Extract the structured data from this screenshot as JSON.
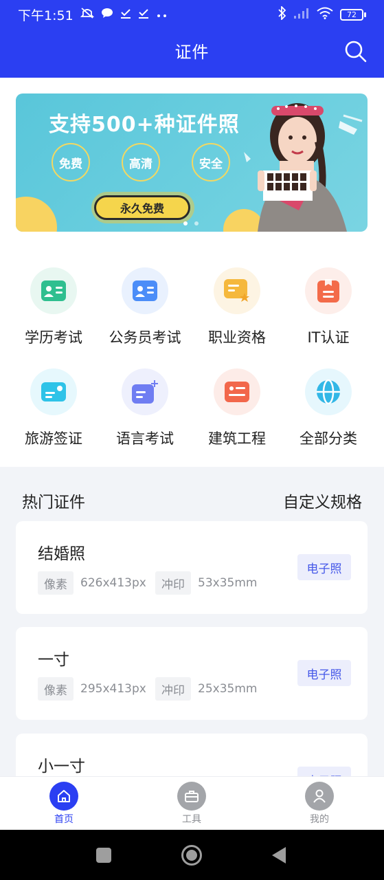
{
  "status_bar": {
    "time": "下午1:51",
    "battery": "72"
  },
  "header": {
    "title": "证件"
  },
  "banner": {
    "title": "支持500+种证件照",
    "badges": [
      "免费",
      "高清",
      "安全"
    ],
    "cta": "永久免费"
  },
  "categories": [
    {
      "label": "学历考试",
      "icon": "student-id-icon",
      "color": "#2fbf8f",
      "bg": "#e8f7f1"
    },
    {
      "label": "公务员考试",
      "icon": "id-card-icon",
      "color": "#4b8df8",
      "bg": "#e9f1fe"
    },
    {
      "label": "职业资格",
      "icon": "certificate-icon",
      "color": "#f5b83d",
      "bg": "#fdf4e3"
    },
    {
      "label": "IT认证",
      "icon": "badge-icon",
      "color": "#f36b4a",
      "bg": "#fdeeea"
    },
    {
      "label": "旅游签证",
      "icon": "visa-icon",
      "color": "#2ec3e8",
      "bg": "#e6f8fd"
    },
    {
      "label": "语言考试",
      "icon": "language-icon",
      "color": "#6f7df2",
      "bg": "#eef0fd"
    },
    {
      "label": "建筑工程",
      "icon": "construction-icon",
      "color": "#f2674b",
      "bg": "#fdece8"
    },
    {
      "label": "全部分类",
      "icon": "globe-icon",
      "color": "#33b7e6",
      "bg": "#e6f7fd"
    }
  ],
  "hot": {
    "title": "热门证件",
    "custom": "自定义规格",
    "pixel_label": "像素",
    "print_label": "冲印",
    "eph_label": "电子照",
    "items": [
      {
        "name": "结婚照",
        "pixels": "626x413px",
        "print": "53x35mm"
      },
      {
        "name": "一寸",
        "pixels": "295x413px",
        "print": "25x35mm"
      },
      {
        "name": "小一寸",
        "pixels": "",
        "print": ""
      }
    ]
  },
  "tabbar": {
    "items": [
      {
        "label": "首页",
        "icon": "home-icon",
        "active": true
      },
      {
        "label": "工具",
        "icon": "toolbox-icon",
        "active": false
      },
      {
        "label": "我的",
        "icon": "user-icon",
        "active": false
      }
    ]
  },
  "colors": {
    "brand": "#2b3ff2",
    "accent_yellow": "#f5d54c",
    "banner_bg": "#62cadc"
  }
}
